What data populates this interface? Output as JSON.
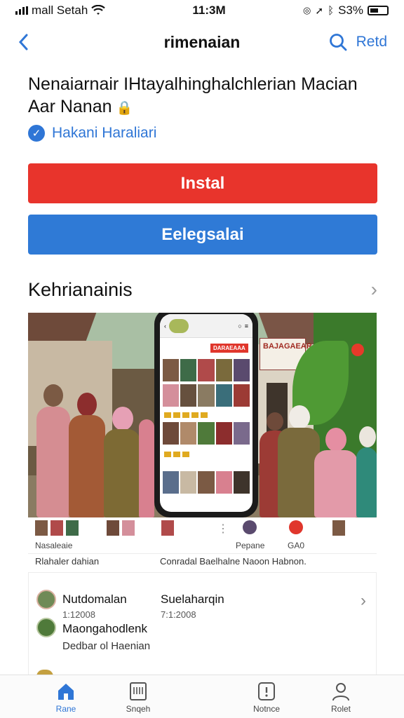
{
  "status_bar": {
    "carrier": "mall Setah",
    "time": "11:3M",
    "battery": "S3%"
  },
  "nav": {
    "title": "rimenaian",
    "right_label": "Retd"
  },
  "app": {
    "title": "Nenaiarnair IHtayalhinghalchlerian Macian Aar Nanan",
    "developer": "Hakani Haraliari",
    "install_label": "Instal",
    "secondary_label": "Eelegsalai"
  },
  "screenshots": {
    "title": "Kehrianainis",
    "sign_text": "BAJAGAEAR",
    "phone_badge": "DARAEAAA",
    "thumb_labels": [
      "Nasaleaie",
      "Pepane",
      "GA0"
    ],
    "caption_left": "Rlahaler dahian",
    "caption_right": "Conradal Baelhalne Naoon Habnon."
  },
  "reviews": {
    "items": [
      {
        "name": "Nutdomalan",
        "date": "1:12008"
      },
      {
        "name": "Suelaharqin",
        "date": "7:1:2008"
      }
    ],
    "second_name": "Maongahodlenk",
    "second_desc": "Dedbar ol Haenian"
  },
  "tabs": [
    {
      "label": "Rane",
      "icon": "home-icon"
    },
    {
      "label": "Snqeh",
      "icon": "store-icon"
    },
    {
      "label": "Notnce",
      "icon": "notice-icon"
    },
    {
      "label": "Rolet",
      "icon": "profile-icon"
    }
  ],
  "colors": {
    "accent": "#2f76d6",
    "install": "#e8342c",
    "secondary": "#2f7ad6"
  }
}
